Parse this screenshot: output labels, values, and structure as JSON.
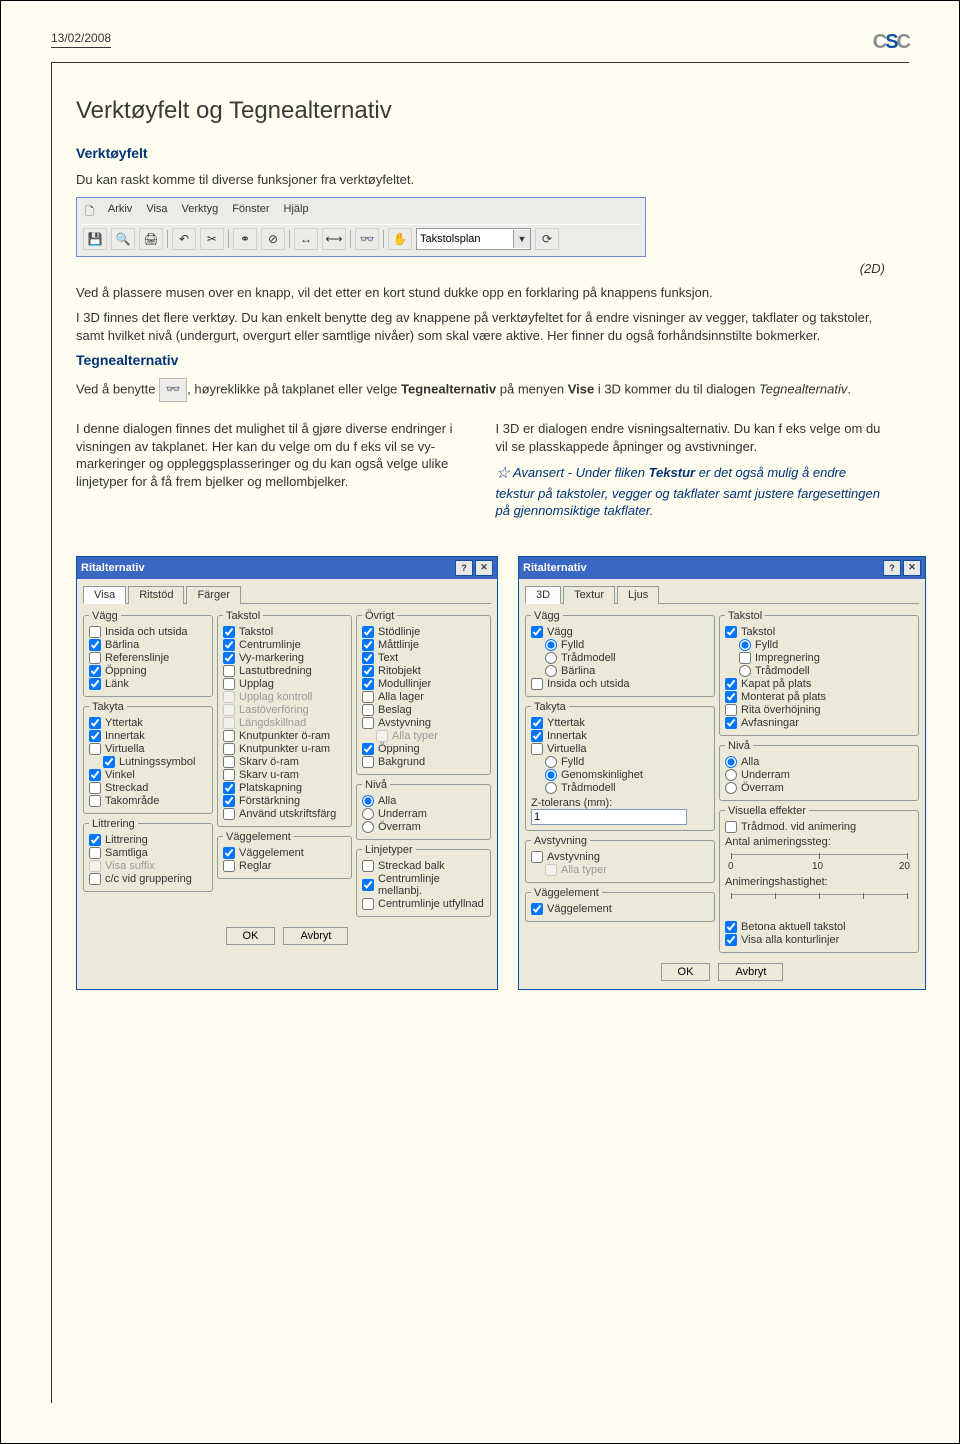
{
  "header": {
    "date": "13/02/2008"
  },
  "title": "Verktøyfelt og Tegnealternativ",
  "section_verktoyfelt": {
    "heading": "Verktøyfelt",
    "intro": "Du kan raskt komme til diverse funksjoner fra verktøyfeltet.",
    "toolbar": {
      "menus": [
        "Arkiv",
        "Visa",
        "Verktyg",
        "Fönster",
        "Hjälp"
      ],
      "dropdown": "Takstolsplan"
    },
    "after_label": "(2D)",
    "para1": "Ved å plassere musen over en knapp, vil det etter en kort stund dukke opp en forklaring på knappens funksjon.",
    "para2": "I 3D finnes det flere verktøy. Du kan enkelt benytte deg av knappene på verktøyfeltet for å endre visninger av vegger, takflater og takstoler, samt hvilket nivå (undergurt, overgurt eller samtlige nivåer) som skal være aktive. Her finner du også forhåndsinnstilte bokmerker."
  },
  "section_tegnealt": {
    "heading": "Tegnealternativ",
    "para1_a": "Ved å benytte",
    "para1_b": ", høyreklikke på takplanet eller velge ",
    "para1_bold1": "Tegnealternativ",
    "para1_c": " på menyen ",
    "para1_bold2": "Vise",
    "para1_d": " i 3D kommer du til dialogen ",
    "para1_ital": "Tegnealternativ",
    "para1_e": ".",
    "left_col": "I denne dialogen finnes det mulighet til å gjøre diverse endringer i visningen av takplanet. Her kan du velge om du f eks vil se vy-markeringer og oppleggsplasseringer og du kan også velge ulike linjetyper for å få frem bjelker og mellombjelker.",
    "right_col_a": "I 3D er dialogen endre visningsalternativ. Du kan f eks velge om du vil se plasskappede åpninger og avstivninger.",
    "tip_lead": "Avansert - Under fliken ",
    "tip_bold": "Tekstur",
    "tip_rest": " er det også mulig å endre tekstur på takstoler, vegger og takflater samt justere fargesettingen på gjennomsiktige takflater."
  },
  "dialog1": {
    "title": "Ritalternativ",
    "tabs": [
      "Visa",
      "Ritstöd",
      "Färger"
    ],
    "groups": {
      "vagg": {
        "legend": "Vägg",
        "items": [
          {
            "label": "Insida och utsida",
            "checked": false,
            "type": "cb"
          },
          {
            "label": "Bärlina",
            "checked": true,
            "type": "cb"
          },
          {
            "label": "Referenslinje",
            "checked": false,
            "type": "cb"
          },
          {
            "label": "Öppning",
            "checked": true,
            "type": "cb"
          },
          {
            "label": "Länk",
            "checked": true,
            "type": "cb"
          }
        ]
      },
      "takyta": {
        "legend": "Takyta",
        "items": [
          {
            "label": "Yttertak",
            "checked": true,
            "type": "cb"
          },
          {
            "label": "Innertak",
            "checked": true,
            "type": "cb"
          },
          {
            "label": "Virtuella",
            "checked": false,
            "type": "cb"
          },
          {
            "label": "Lutningssymbol",
            "checked": true,
            "type": "cb",
            "indent": true
          },
          {
            "label": "Vinkel",
            "checked": true,
            "type": "cb"
          },
          {
            "label": "Streckad",
            "checked": false,
            "type": "cb"
          },
          {
            "label": "Takområde",
            "checked": false,
            "type": "cb"
          }
        ]
      },
      "littrering": {
        "legend": "Littrering",
        "items": [
          {
            "label": "Littrering",
            "checked": true,
            "type": "cb"
          },
          {
            "label": "Samtliga",
            "checked": false,
            "type": "cb"
          },
          {
            "label": "Visa suffix",
            "checked": false,
            "type": "cb",
            "disabled": true
          },
          {
            "label": "c/c vid gruppering",
            "checked": false,
            "type": "cb"
          }
        ]
      },
      "takstol": {
        "legend": "Takstol",
        "items": [
          {
            "label": "Takstol",
            "checked": true,
            "type": "cb"
          },
          {
            "label": "Centrumlinje",
            "checked": true,
            "type": "cb"
          },
          {
            "label": "Vy-markering",
            "checked": true,
            "type": "cb"
          },
          {
            "label": "Lastutbredning",
            "checked": false,
            "type": "cb"
          },
          {
            "label": "Upplag",
            "checked": false,
            "type": "cb"
          },
          {
            "label": "Upplag kontroll",
            "checked": false,
            "type": "cb",
            "disabled": true
          },
          {
            "label": "Lastöverföring",
            "checked": false,
            "type": "cb",
            "disabled": true
          },
          {
            "label": "Längdskillnad",
            "checked": false,
            "type": "cb",
            "disabled": true
          },
          {
            "label": "Knutpunkter ö-ram",
            "checked": false,
            "type": "cb"
          },
          {
            "label": "Knutpunkter u-ram",
            "checked": false,
            "type": "cb"
          },
          {
            "label": "Skarv ö-ram",
            "checked": false,
            "type": "cb"
          },
          {
            "label": "Skarv u-ram",
            "checked": false,
            "type": "cb"
          },
          {
            "label": "Platskapning",
            "checked": true,
            "type": "cb"
          },
          {
            "label": "Förstärkning",
            "checked": true,
            "type": "cb"
          },
          {
            "label": "Använd utskriftsfärg",
            "checked": false,
            "type": "cb"
          }
        ]
      },
      "vaggelement": {
        "legend": "Väggelement",
        "items": [
          {
            "label": "Väggelement",
            "checked": true,
            "type": "cb"
          },
          {
            "label": "Reglar",
            "checked": false,
            "type": "cb"
          }
        ]
      },
      "ovrigt": {
        "legend": "Övrigt",
        "items": [
          {
            "label": "Stödlinje",
            "checked": true,
            "type": "cb"
          },
          {
            "label": "Måttlinje",
            "checked": true,
            "type": "cb"
          },
          {
            "label": "Text",
            "checked": true,
            "type": "cb"
          },
          {
            "label": "Ritobjekt",
            "checked": true,
            "type": "cb"
          },
          {
            "label": "Modullinjer",
            "checked": true,
            "type": "cb"
          },
          {
            "label": "Alla lager",
            "checked": false,
            "type": "cb"
          },
          {
            "label": "Beslag",
            "checked": false,
            "type": "cb"
          },
          {
            "label": "Avstyvning",
            "checked": false,
            "type": "cb"
          },
          {
            "label": "Alla typer",
            "checked": false,
            "type": "cb",
            "disabled": true,
            "indent": true
          },
          {
            "label": "Öppning",
            "checked": true,
            "type": "cb"
          },
          {
            "label": "Bakgrund",
            "checked": false,
            "type": "cb"
          }
        ]
      },
      "niva": {
        "legend": "Nivå",
        "items": [
          {
            "label": "Alla",
            "checked": true,
            "type": "radio"
          },
          {
            "label": "Underram",
            "checked": false,
            "type": "radio"
          },
          {
            "label": "Överram",
            "checked": false,
            "type": "radio"
          }
        ]
      },
      "linjetyper": {
        "legend": "Linjetyper",
        "items": [
          {
            "label": "Streckad balk",
            "checked": false,
            "type": "cb"
          },
          {
            "label": "Centrumlinje mellanbj.",
            "checked": true,
            "type": "cb"
          },
          {
            "label": "Centrumlinje utfyllnad",
            "checked": false,
            "type": "cb"
          }
        ]
      }
    },
    "buttons": {
      "ok": "OK",
      "cancel": "Avbryt"
    }
  },
  "dialog2": {
    "title": "Ritalternativ",
    "tabs": [
      "3D",
      "Textur",
      "Ljus"
    ],
    "groups": {
      "vagg": {
        "legend": "Vägg",
        "items": [
          {
            "label": "Vägg",
            "checked": true,
            "type": "cb"
          },
          {
            "label": "Fylld",
            "checked": true,
            "type": "radio",
            "indent": true
          },
          {
            "label": "Trådmodell",
            "checked": false,
            "type": "radio",
            "indent": true
          },
          {
            "label": "Bärlina",
            "checked": false,
            "type": "radio",
            "indent": true
          },
          {
            "label": "Insida och utsida",
            "checked": false,
            "type": "cb"
          }
        ]
      },
      "takyta": {
        "legend": "Takyta",
        "items": [
          {
            "label": "Yttertak",
            "checked": true,
            "type": "cb"
          },
          {
            "label": "Innertak",
            "checked": true,
            "type": "cb"
          },
          {
            "label": "Virtuella",
            "checked": false,
            "type": "cb"
          },
          {
            "label": "Fylld",
            "checked": false,
            "type": "radio",
            "indent": true
          },
          {
            "label": "Genomskinlighet",
            "checked": true,
            "type": "radio",
            "indent": true
          },
          {
            "label": "Trådmodell",
            "checked": false,
            "type": "radio",
            "indent": true
          }
        ],
        "zlabel": "Z-tolerans (mm):",
        "zval": "1"
      },
      "avstyvning": {
        "legend": "Avstyvning",
        "items": [
          {
            "label": "Avstyvning",
            "checked": false,
            "type": "cb"
          },
          {
            "label": "Alla typer",
            "checked": false,
            "type": "cb",
            "disabled": true,
            "indent": true
          }
        ]
      },
      "vaggelement": {
        "legend": "Väggelement",
        "items": [
          {
            "label": "Väggelement",
            "checked": true,
            "type": "cb"
          }
        ]
      },
      "takstol": {
        "legend": "Takstol",
        "items": [
          {
            "label": "Takstol",
            "checked": true,
            "type": "cb"
          },
          {
            "label": "Fylld",
            "checked": true,
            "type": "radio",
            "indent": true
          },
          {
            "label": "Impregnering",
            "checked": false,
            "type": "cb",
            "indent": true
          },
          {
            "label": "Trådmodell",
            "checked": false,
            "type": "radio",
            "indent": true
          },
          {
            "label": "Kapat på plats",
            "checked": true,
            "type": "cb"
          },
          {
            "label": "Monterat på plats",
            "checked": true,
            "type": "cb"
          },
          {
            "label": "Rita överhöjning",
            "checked": false,
            "type": "cb"
          },
          {
            "label": "Avfasningar",
            "checked": true,
            "type": "cb"
          }
        ]
      },
      "niva": {
        "legend": "Nivå",
        "items": [
          {
            "label": "Alla",
            "checked": true,
            "type": "radio"
          },
          {
            "label": "Underram",
            "checked": false,
            "type": "radio"
          },
          {
            "label": "Överram",
            "checked": false,
            "type": "radio"
          }
        ]
      },
      "visuella": {
        "legend": "Visuella effekter",
        "items": [
          {
            "label": "Trådmod. vid animering",
            "checked": false,
            "type": "cb"
          }
        ],
        "steg_label": "Antal animeringssteg:",
        "steg_ticks": [
          "0",
          "10",
          "20"
        ],
        "hast_label": "Animeringshastighet:",
        "tail": [
          {
            "label": "Betona aktuell takstol",
            "checked": true,
            "type": "cb"
          },
          {
            "label": "Visa alla konturlinjer",
            "checked": true,
            "type": "cb"
          }
        ]
      }
    },
    "buttons": {
      "ok": "OK",
      "cancel": "Avbryt"
    }
  }
}
